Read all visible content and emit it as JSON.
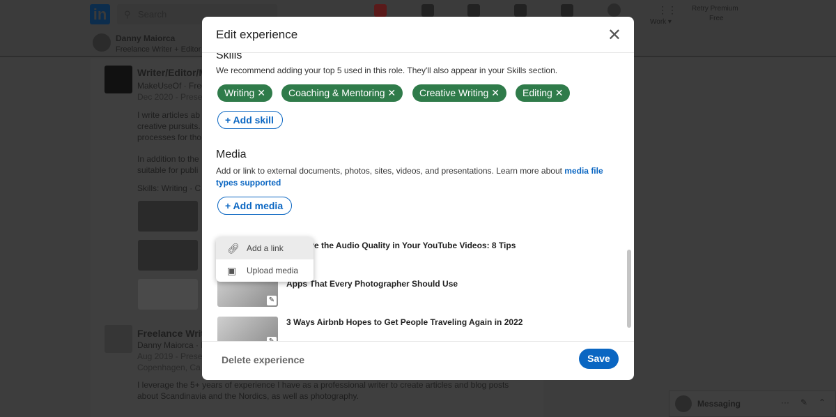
{
  "background": {
    "search_placeholder": "Search",
    "nav": {
      "work": "Work ▾",
      "premium_line1": "Retry Premium",
      "premium_line2": "Free"
    },
    "profile": {
      "name": "Danny Maiorca",
      "headline": "Freelance Writer + Editor"
    },
    "experience": [
      {
        "title": "Writer/Editor/M",
        "company": "MakeUseOf · Free",
        "dates": "Dec 2020 - Prese",
        "desc": [
          "I write articles ab",
          "creative pursuits.",
          "processes for tho",
          "",
          "In addition to the",
          "suitable for publi"
        ],
        "skills": "Skills: Writing · C"
      },
      {
        "title": "Freelance Writ",
        "company": "Danny Maiorca · F",
        "dates": "Aug 2019 - Prese",
        "location": "Copenhagen, Ca"
      }
    ],
    "body_text": [
      "I leverage the 5+ years of experience I have as a professional writer to create articles and blog posts",
      "about Scandinavia and the Nordics, as well as photography."
    ],
    "messaging": "Messaging"
  },
  "modal": {
    "title": "Edit experience",
    "skills": {
      "heading": "Skills",
      "description": "We recommend adding your top 5 used in this role. They'll also appear in your Skills section.",
      "chips": [
        "Writing",
        "Coaching & Mentoring",
        "Creative Writing",
        "Editing"
      ],
      "add_label": "Add skill"
    },
    "media": {
      "heading": "Media",
      "description": "Add or link to external documents, photos, sites, videos, and presentations. Learn more about ",
      "link_text": "media file types supported",
      "add_label": "Add media",
      "menu": [
        "Add a link",
        "Upload media"
      ],
      "items": [
        "Improve the Audio Quality in Your YouTube Videos: 8 Tips",
        "Apps That Every Photographer Should Use",
        "3 Ways Airbnb Hopes to Get People Traveling Again in 2022"
      ]
    },
    "delete_label": "Delete experience",
    "save_label": "Save"
  }
}
